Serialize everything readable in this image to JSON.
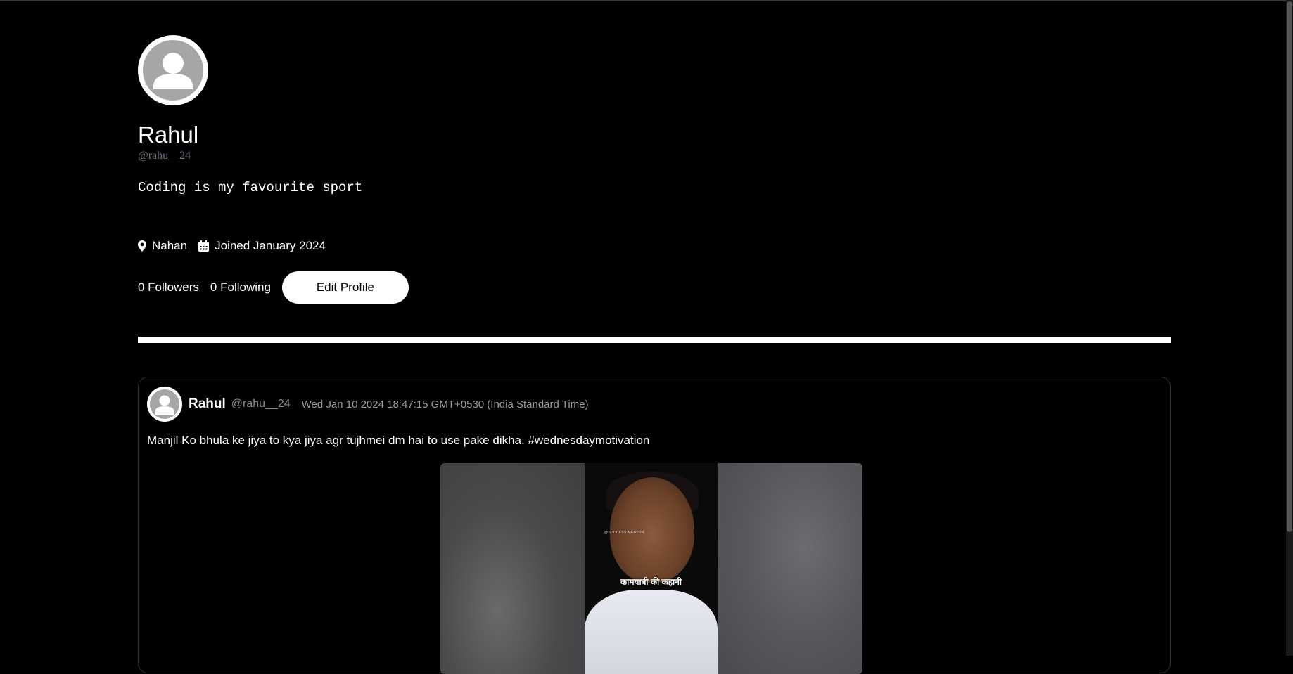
{
  "profile": {
    "name": "Rahul",
    "handle": "@rahu__24",
    "bio": "Coding is my favourite sport",
    "location": "Nahan",
    "joined": "Joined January 2024",
    "followers": "0 Followers",
    "following": "0 Following",
    "edit_button": "Edit Profile"
  },
  "post": {
    "author_name": "Rahul",
    "author_handle": "@rahu__24",
    "date": "Wed Jan 10 2024 18:47:15 GMT+0530 (India Standard Time)",
    "text": "Manjil Ko bhula ke jiya to kya jiya agr tujhmei dm hai to use pake dikha. #wednesdaymotivation",
    "media": {
      "watermark": "@SUCCESS.MENTOR",
      "caption": "कामयाबी की कहानी"
    }
  },
  "colors": {
    "background": "#000000",
    "divider": "#ffffff",
    "handle": "#6b7280",
    "button_bg": "#ffffff"
  },
  "icons": {
    "location": "map-pin-icon",
    "joined": "calendar-icon",
    "avatar": "user-placeholder-icon"
  }
}
